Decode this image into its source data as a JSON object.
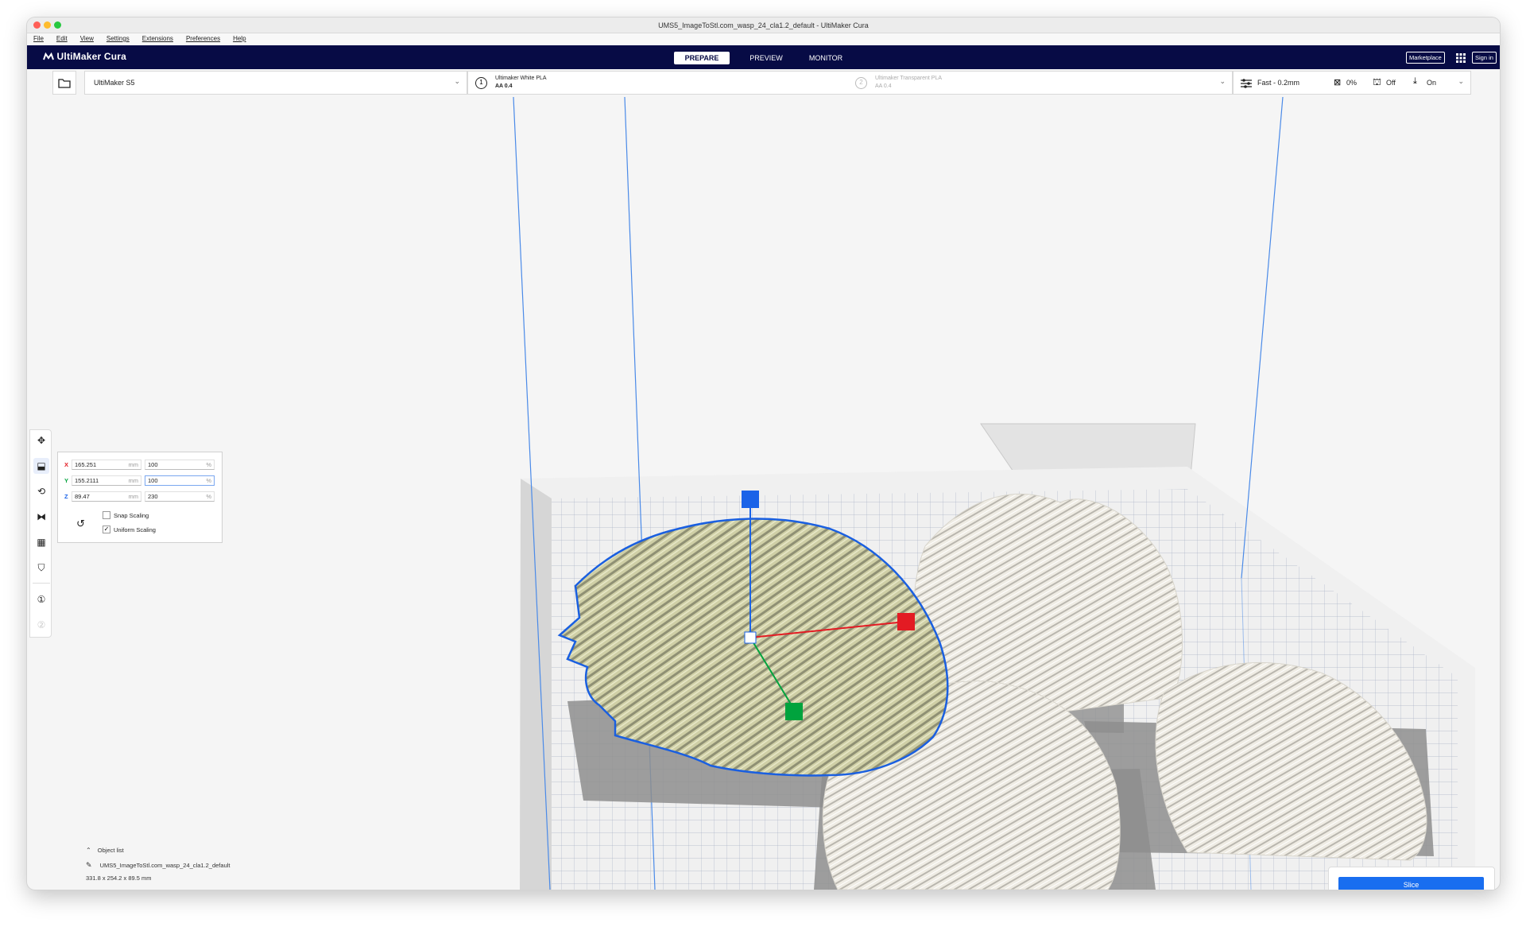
{
  "window": {
    "title": "UMS5_ImageToStl.com_wasp_24_cla1.2_default - UltiMaker Cura"
  },
  "menu": [
    "File",
    "Edit",
    "View",
    "Settings",
    "Extensions",
    "Preferences",
    "Help"
  ],
  "header": {
    "logo": "UltiMaker Cura",
    "tabs": [
      "PREPARE",
      "PREVIEW",
      "MONITOR"
    ],
    "marketplace": "Marketplace",
    "sign_in": "Sign in"
  },
  "printer": {
    "name": "UltiMaker S5"
  },
  "extruders": [
    {
      "number": "1",
      "material": "Ultimaker White PLA",
      "core": "AA 0.4"
    },
    {
      "number": "2",
      "material": "Ultimaker Transparent PLA",
      "core": "AA 0.4"
    }
  ],
  "print_settings": {
    "profile": "Fast - 0.2mm",
    "infill": "0%",
    "support": "Off",
    "adhesion": "On"
  },
  "scale_panel": {
    "x": {
      "label": "X",
      "mm": "165.251",
      "percent": "100"
    },
    "y": {
      "label": "Y",
      "mm": "155.2111",
      "percent": "100"
    },
    "z": {
      "label": "Z",
      "mm": "89.47",
      "percent": "230"
    },
    "unit_mm": "mm",
    "unit_pct": "%",
    "snap_scaling": "Snap Scaling",
    "uniform_scaling": "Uniform Scaling",
    "uniform_checked": "✓"
  },
  "object_list": {
    "header": "Object list",
    "name": "UMS5_ImageToStl.com_wasp_24_cla1.2_default",
    "dims": "331.8 x 254.2 x 89.5 mm"
  },
  "slice": {
    "label": "Slice"
  },
  "colors": {
    "header": "#070b45",
    "accent": "#196ef0",
    "selection": "#1a5fe0",
    "x_axis": "#e31b23",
    "y_axis": "#00a33d",
    "z_axis": "#1a63e8"
  }
}
